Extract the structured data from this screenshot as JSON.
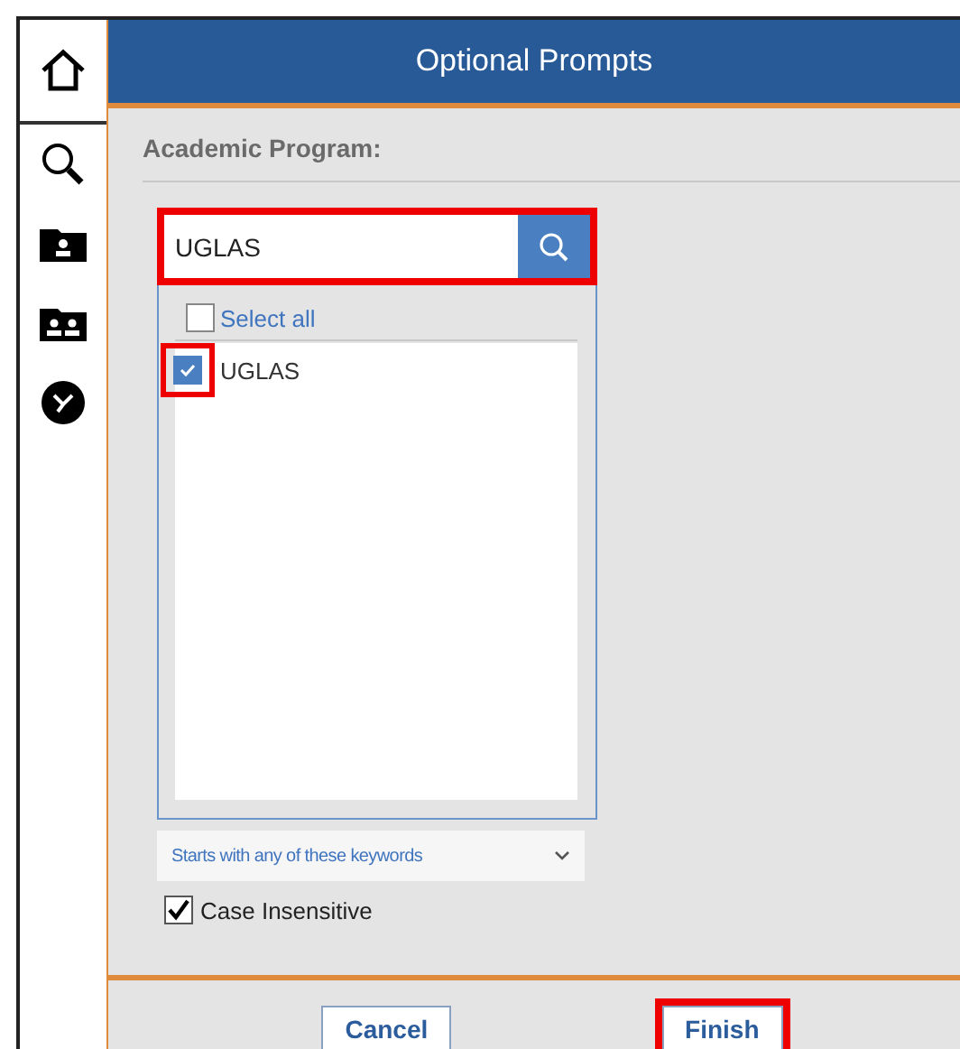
{
  "sidebar": {
    "items": [
      {
        "kind": "home",
        "selected": true
      },
      {
        "kind": "search",
        "selected": false
      },
      {
        "kind": "folder-person",
        "selected": false
      },
      {
        "kind": "folder-people",
        "selected": false
      },
      {
        "kind": "clock",
        "selected": false
      }
    ]
  },
  "dialog": {
    "title": "Optional Prompts",
    "prompt_label": "Academic Program:",
    "search": {
      "value": "UGLAS",
      "highlighted": true
    },
    "select_all": {
      "label": "Select all",
      "checked": false
    },
    "options": [
      {
        "label": "UGLAS",
        "checked": true,
        "highlighted": true
      }
    ],
    "match_mode": {
      "value": "Starts with any of these keywords"
    },
    "case_insensitive": {
      "label": "Case Insensitive",
      "checked": true
    },
    "buttons": [
      {
        "label": "Cancel",
        "highlighted": false
      },
      {
        "label": "Finish",
        "highlighted": true
      }
    ]
  }
}
